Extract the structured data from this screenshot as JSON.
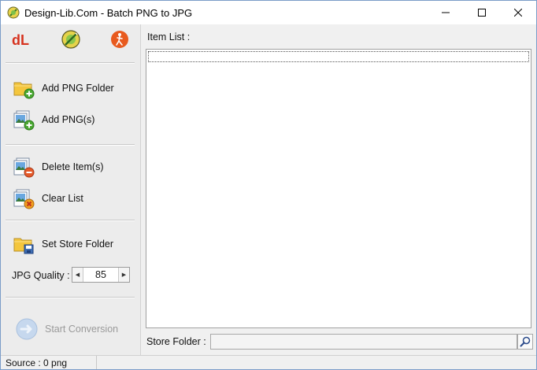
{
  "window": {
    "title": "Design-Lib.Com - Batch PNG to JPG"
  },
  "toolbar_icons": [
    {
      "name": "dl-logo-icon"
    },
    {
      "name": "pencil-globe-icon"
    },
    {
      "name": "walking-person-icon"
    }
  ],
  "sidebar": {
    "add_png_folder": "Add PNG Folder",
    "add_pngs": "Add PNG(s)",
    "delete_items": "Delete Item(s)",
    "clear_list": "Clear List",
    "set_store_folder": "Set Store Folder",
    "jpg_quality_label": "JPG Quality :",
    "jpg_quality_value": "85",
    "start_conversion": "Start Conversion"
  },
  "main": {
    "item_list_label": "Item List :",
    "store_folder_label": "Store Folder :",
    "store_folder_value": ""
  },
  "status": {
    "source_text": "Source : 0  png"
  },
  "colors": {
    "accent_green": "#4aa832",
    "folder_yellow": "#f4c63d",
    "delete_red": "#d9534f",
    "logo_red": "#d6321e",
    "disabled_text": "#9a9a9a"
  }
}
